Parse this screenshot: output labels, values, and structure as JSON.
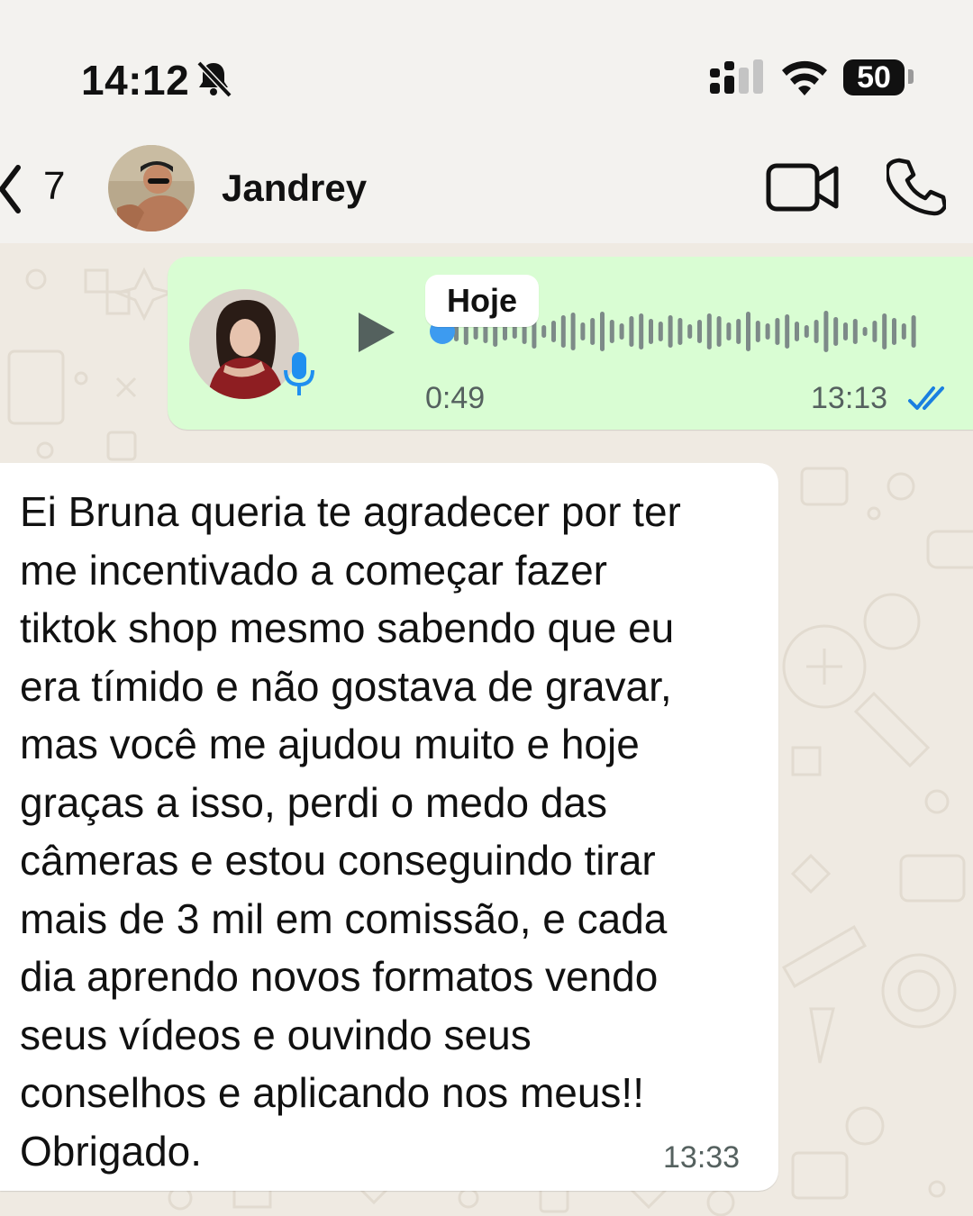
{
  "status_bar": {
    "time": "14:12",
    "battery": "50"
  },
  "header": {
    "unread_count": "7",
    "contact_name": "Jandrey"
  },
  "audio_message": {
    "date_label": "Hoje",
    "duration": "0:49",
    "time": "13:13",
    "progress": 0
  },
  "text_message": {
    "body": "Ei Bruna queria te agradecer por ter\nme incentivado a começar fazer\ntiktok shop mesmo sabendo que eu\nera tímido e não gostava de gravar,\nmas você me ajudou muito e hoje\ngraças a isso, perdi o medo das\ncâmeras e estou conseguindo tirar\nmais de 3 mil em comissão, e cada\ndia aprendo novos formatos vendo\nseus vídeos e ouvindo seus\nconselhos e aplicando nos meus!!\nObrigado.",
    "time": "13:33"
  },
  "colors": {
    "outgoing_bubble": "#d9fdd3",
    "incoming_bubble": "#ffffff",
    "read_ticks": "#1a7fe0",
    "waveform": "#7d8a88",
    "background": "#efeae2"
  }
}
